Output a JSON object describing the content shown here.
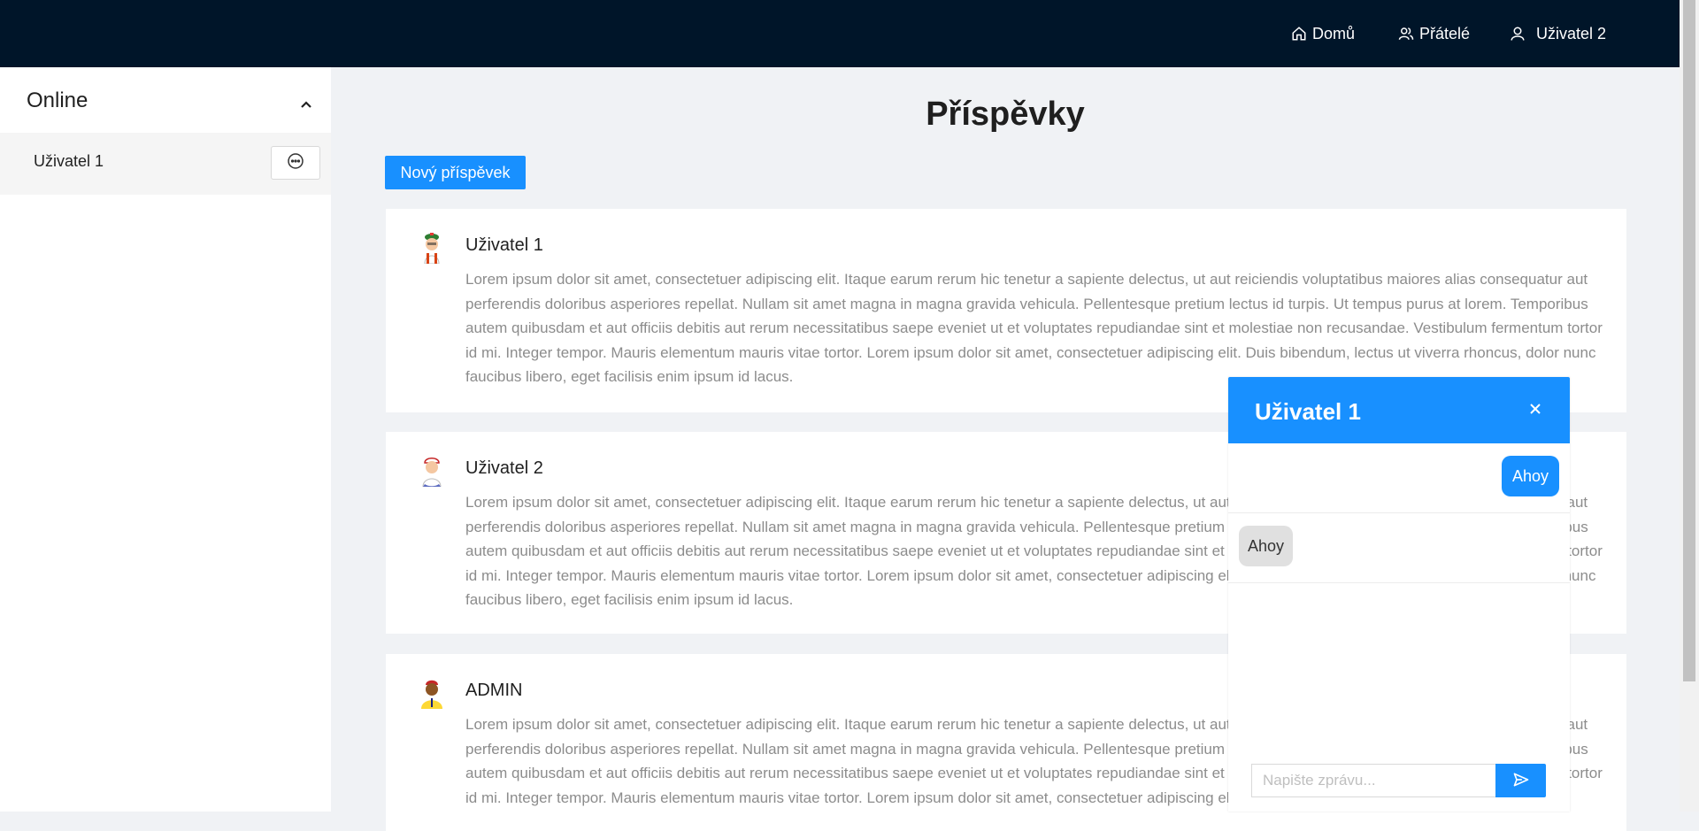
{
  "nav": {
    "home": "Domů",
    "friends": "Přátelé",
    "user": "Uživatel 2"
  },
  "sidebar": {
    "heading": "Online",
    "items": [
      {
        "label": "Uživatel 1"
      }
    ]
  },
  "main": {
    "title": "Příspěvky",
    "new_post_label": "Nový příspěvek",
    "posts": [
      {
        "author": "Uživatel 1",
        "body": "Lorem ipsum dolor sit amet, consectetuer adipiscing elit. Itaque earum rerum hic tenetur a sapiente delectus, ut aut reiciendis voluptatibus maiores alias consequatur aut perferendis doloribus asperiores repellat. Nullam sit amet magna in magna gravida vehicula. Pellentesque pretium lectus id turpis. Ut tempus purus at lorem. Temporibus autem quibusdam et aut officiis debitis aut rerum necessitatibus saepe eveniet ut et voluptates repudiandae sint et molestiae non recusandae. Vestibulum fermentum tortor id mi. Integer tempor. Mauris elementum mauris vitae tortor. Lorem ipsum dolor sit amet, consectetuer adipiscing elit. Duis bibendum, lectus ut viverra rhoncus, dolor nunc faucibus libero, eget facilisis enim ipsum id lacus."
      },
      {
        "author": "Uživatel 2",
        "body": "Lorem ipsum dolor sit amet, consectetuer adipiscing elit. Itaque earum rerum hic tenetur a sapiente delectus, ut aut reiciendis voluptatibus maiores alias consequatur aut perferendis doloribus asperiores repellat. Nullam sit amet magna in magna gravida vehicula. Pellentesque pretium lectus id turpis. Ut tempus purus at lorem. Temporibus autem quibusdam et aut officiis debitis aut rerum necessitatibus saepe eveniet ut et voluptates repudiandae sint et molestiae non recusandae. Vestibulum fermentum tortor id mi. Integer tempor. Mauris elementum mauris vitae tortor. Lorem ipsum dolor sit amet, consectetuer adipiscing elit. Duis bibendum, lectus ut viverra rhoncus, dolor nunc faucibus libero, eget facilisis enim ipsum id lacus."
      },
      {
        "author": "ADMIN",
        "body": "Lorem ipsum dolor sit amet, consectetuer adipiscing elit. Itaque earum rerum hic tenetur a sapiente delectus, ut aut reiciendis voluptatibus maiores alias consequatur aut perferendis doloribus asperiores repellat. Nullam sit amet magna in magna gravida vehicula. Pellentesque pretium lectus id turpis. Ut tempus purus at lorem. Temporibus autem quibusdam et aut officiis debitis aut rerum necessitatibus saepe eveniet ut et voluptates repudiandae sint et molestiae non recusandae. Vestibulum fermentum tortor id mi. Integer tempor. Mauris elementum mauris vitae tortor. Lorem ipsum dolor sit amet, consectetuer adipiscing elit."
      }
    ]
  },
  "chat": {
    "title": "Uživatel 1",
    "messages": [
      {
        "direction": "outgoing",
        "text": "Ahoy"
      },
      {
        "direction": "incoming",
        "text": "Ahoy"
      }
    ],
    "input_placeholder": "Napište zprávu..."
  },
  "icons": {
    "home": "home-icon",
    "friends": "team-icon",
    "user": "user-icon",
    "collapse": "chevron-up-icon",
    "chat": "message-icon",
    "close": "close-icon",
    "send": "send-icon"
  },
  "colors": {
    "header_bg": "#001529",
    "primary": "#1890ff",
    "page_bg": "#f0f2f5",
    "muted_text": "#8c8c8c"
  }
}
